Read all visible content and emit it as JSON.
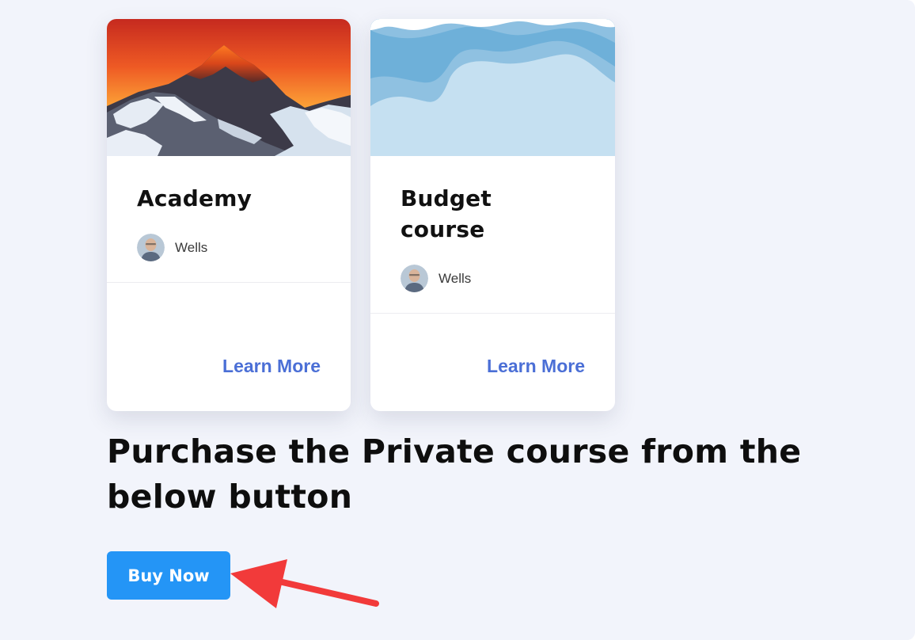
{
  "cards": [
    {
      "title": "Academy",
      "author": "Wells",
      "action": "Learn More",
      "thumbnail": "mountain-sunset-image"
    },
    {
      "title": "Budget course",
      "author": "Wells",
      "action": "Learn More",
      "thumbnail": "blue-waves-image"
    }
  ],
  "headline": "Purchase the Private course from the below button",
  "buy_button": {
    "label": "Buy Now"
  },
  "colors": {
    "page_background": "#f2f4fb",
    "link": "#4b6fd6",
    "button": "#2495f6",
    "arrow": "#f23a3a"
  },
  "icons": {
    "annotation": "arrow-icon",
    "avatar": "author-avatar"
  }
}
